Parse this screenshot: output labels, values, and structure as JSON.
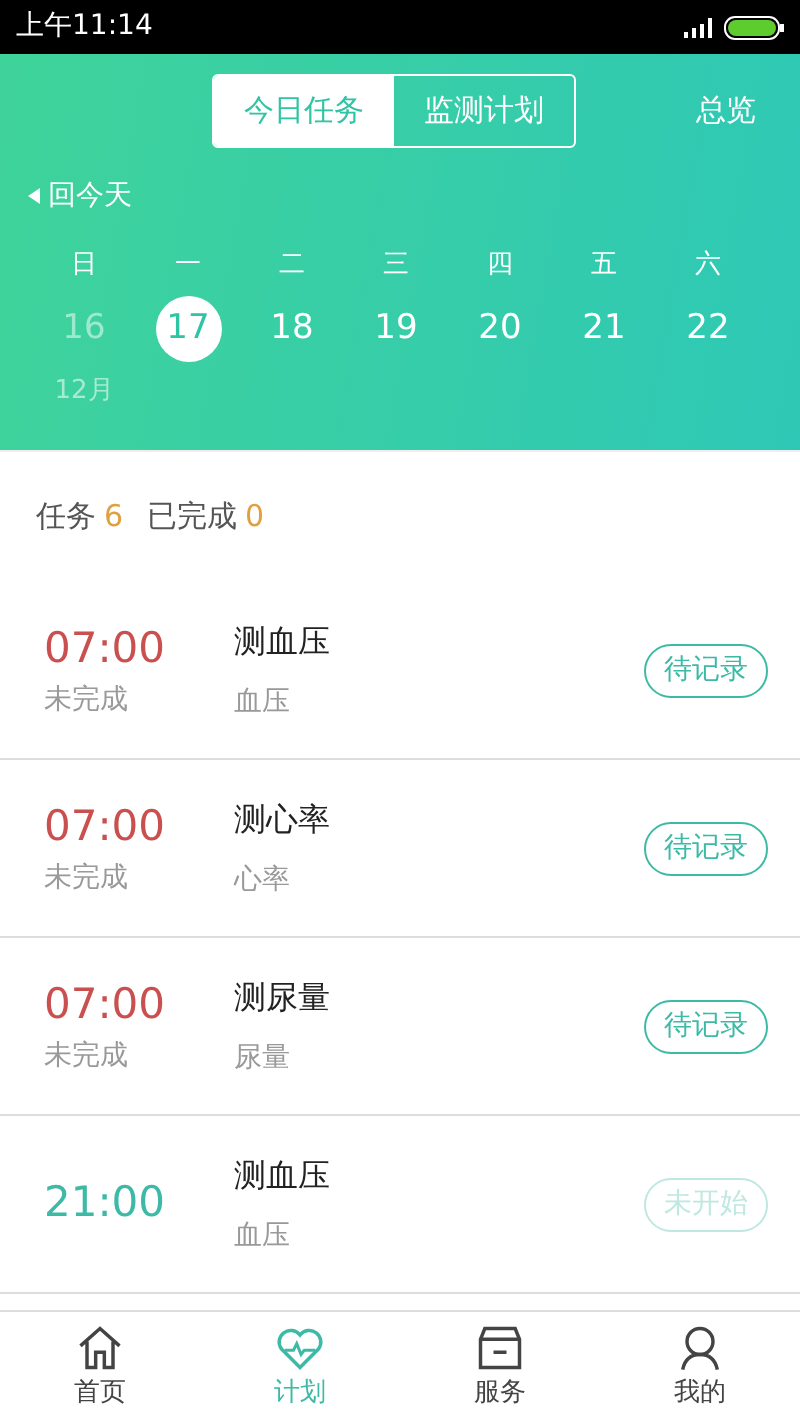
{
  "status_bar": {
    "time": "上午11:14"
  },
  "header": {
    "tabs": [
      {
        "label": "今日任务",
        "selected": true
      },
      {
        "label": "监测计划",
        "selected": false
      }
    ],
    "overview": "总览",
    "back_today": "回今天",
    "weekdays": [
      "日",
      "一",
      "二",
      "三",
      "四",
      "五",
      "六"
    ],
    "days": [
      {
        "label": "16",
        "selected": false,
        "muted": true
      },
      {
        "label": "17",
        "selected": true,
        "muted": false
      },
      {
        "label": "18",
        "selected": false,
        "muted": false
      },
      {
        "label": "19",
        "selected": false,
        "muted": false
      },
      {
        "label": "20",
        "selected": false,
        "muted": false
      },
      {
        "label": "21",
        "selected": false,
        "muted": false
      },
      {
        "label": "22",
        "selected": false,
        "muted": false
      }
    ],
    "month": "12月"
  },
  "summary": {
    "tasks_label": "任务",
    "tasks_count": "6",
    "done_label": "已完成",
    "done_count": "0"
  },
  "tasks": [
    {
      "kind": "overdue",
      "time": "07:00",
      "status": "未完成",
      "title": "测血压",
      "subtitle": "血压",
      "action": "待记录",
      "disabled": false
    },
    {
      "kind": "overdue",
      "time": "07:00",
      "status": "未完成",
      "title": "测心率",
      "subtitle": "心率",
      "action": "待记录",
      "disabled": false
    },
    {
      "kind": "overdue",
      "time": "07:00",
      "status": "未完成",
      "title": "测尿量",
      "subtitle": "尿量",
      "action": "待记录",
      "disabled": false
    },
    {
      "kind": "upcoming",
      "time": "21:00",
      "title": "测血压",
      "subtitle": "血压",
      "action": "未开始",
      "disabled": true
    }
  ],
  "bottom_nav": [
    {
      "kind": "home",
      "label": "首页",
      "selected": false
    },
    {
      "kind": "plan",
      "label": "计划",
      "selected": true
    },
    {
      "kind": "service",
      "label": "服务",
      "selected": false
    },
    {
      "kind": "profile",
      "label": "我的",
      "selected": false
    }
  ]
}
